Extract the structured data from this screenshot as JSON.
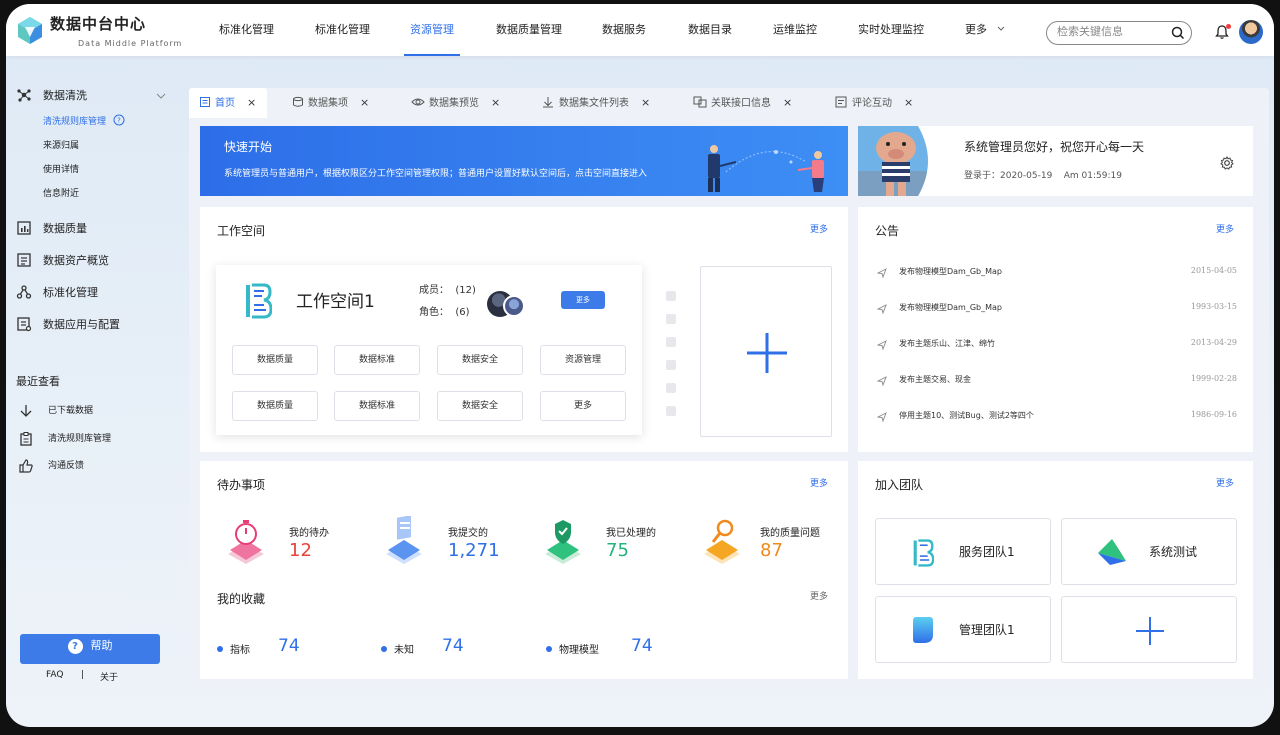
{
  "header": {
    "brand": "数据中台中心",
    "brand_sub": "Data Middle Platform",
    "nav": [
      "标准化管理",
      "标准化管理",
      "资源管理",
      "数据质量管理",
      "数据服务",
      "数据目录",
      "运维监控",
      "实时处理监控",
      "更多"
    ],
    "active_nav": "资源管理",
    "search_placeholder": "检索关键信息"
  },
  "sidebar": {
    "group1": "数据清洗",
    "sub_items": [
      "清洗规则库管理",
      "来源归属",
      "使用详情",
      "信息附近"
    ],
    "items": [
      "数据质量",
      "数据资产概览",
      "标准化管理",
      "数据应用与配置"
    ],
    "recent_title": "最近查看",
    "recent": [
      "已下载数据",
      "清洗规则库管理",
      "沟通反馈"
    ],
    "help": "帮助",
    "faq": "FAQ",
    "sep": "|",
    "about": "关于",
    "help_q": "?"
  },
  "tabs": [
    "首页",
    "数据集项",
    "数据集预览",
    "数据集文件列表",
    "关联接口信息",
    "评论互动"
  ],
  "tab_close": "×",
  "banner": {
    "title": "快速开始",
    "text": "系统管理员与普通用户，根据权限区分工作空间管理权限；普通用户设置好默认空间后，点击空间直接进入"
  },
  "greeting": {
    "text": "系统管理员您好，祝您开心每一天",
    "login": "登录于：2020-05-19    Am 01:59:19"
  },
  "workspace": {
    "title": "工作空间",
    "more": "更多",
    "name": "工作空间1",
    "members": "成员：  (12)",
    "roles": "角色：  (6)",
    "more_btn": "更多",
    "buttons": [
      "数据质量",
      "数据标准",
      "数据安全",
      "资源管理",
      "数据质量",
      "数据标准",
      "数据安全",
      "更多"
    ]
  },
  "notice": {
    "title": "公告",
    "more": "更多",
    "rows": [
      {
        "text": "发布物理模型Dam_Gb_Map",
        "date": "2015-04-05"
      },
      {
        "text": "发布物理模型Dam_Gb_Map",
        "date": "1993-03-15"
      },
      {
        "text": "发布主题乐山、江津、绵竹",
        "date": "2013-04-29"
      },
      {
        "text": "发布主题交易、现金",
        "date": "1999-02-28"
      },
      {
        "text": "停用主题10、测试Bug、测试2等四个",
        "date": "1986-09-16"
      }
    ]
  },
  "todo": {
    "title": "待办事项",
    "more": "更多",
    "stats": [
      {
        "label": "我的待办",
        "value": "12",
        "color": "#e8433b"
      },
      {
        "label": "我提交的",
        "value": "1,271",
        "color": "#2f6fe8"
      },
      {
        "label": "我已处理的",
        "value": "75",
        "color": "#23b37a"
      },
      {
        "label": "我的质量问题",
        "value": "87",
        "color": "#f08a1c"
      }
    ]
  },
  "favorites": {
    "title": "我的收藏",
    "more": "更多",
    "items": [
      {
        "label": "指标",
        "value": "74"
      },
      {
        "label": "未知",
        "value": "74"
      },
      {
        "label": "物理模型",
        "value": "74"
      }
    ]
  },
  "team": {
    "title": "加入团队",
    "more": "更多",
    "teams": [
      "服务团队1",
      "系统测试",
      "管理团队1"
    ]
  }
}
